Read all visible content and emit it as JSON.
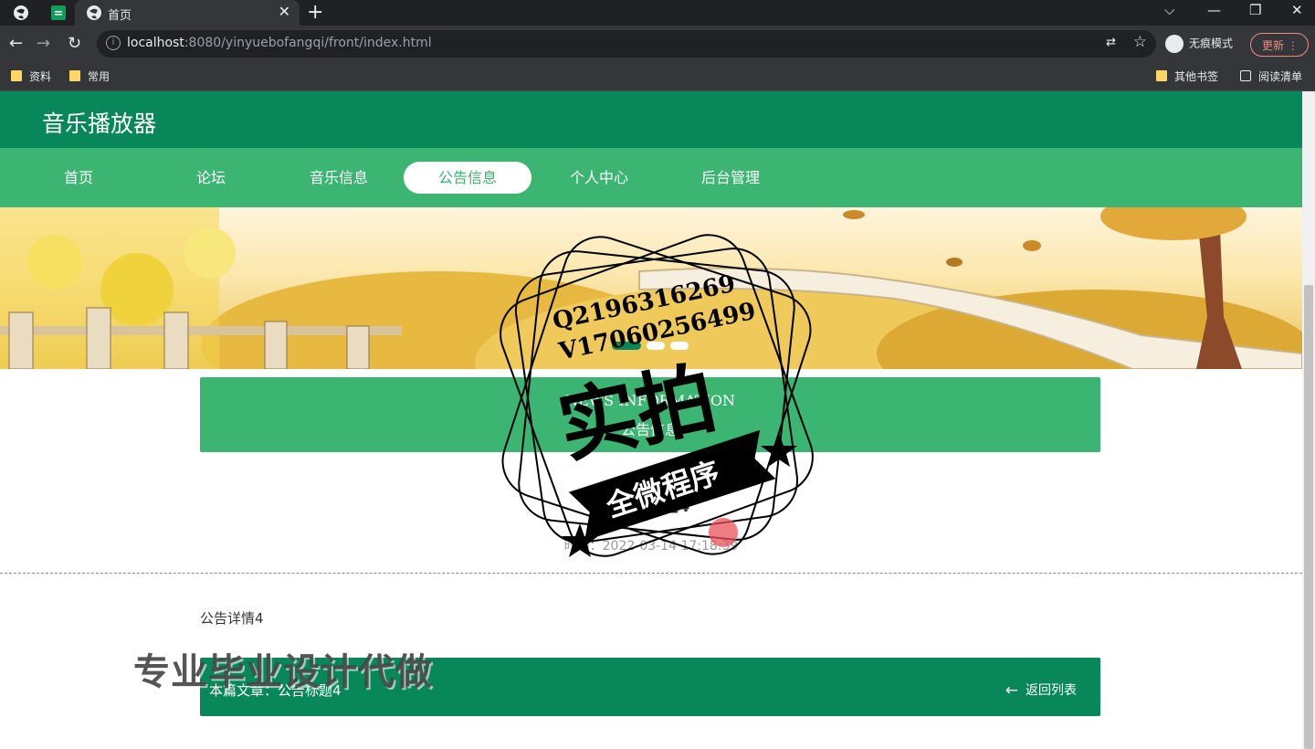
{
  "browser": {
    "tab_title": "首页",
    "url_host": "localhost",
    "url_rest": ":8080/yinyuebofangqi/front/index.html",
    "incognito_label": "无痕模式",
    "update_label": "更新",
    "bookmarks": [
      {
        "label": "资料"
      },
      {
        "label": "常用"
      }
    ],
    "other_bookmarks": "其他书签",
    "reading_list": "阅读清单"
  },
  "site": {
    "title": "音乐播放器",
    "nav": [
      {
        "label": "首页"
      },
      {
        "label": "论坛"
      },
      {
        "label": "音乐信息"
      },
      {
        "label": "公告信息",
        "active": true
      },
      {
        "label": "个人中心"
      },
      {
        "label": "后台管理"
      }
    ],
    "accent": "#3cb472",
    "header_color": "#07875a"
  },
  "section": {
    "title_en": "NEWS INFORMATION",
    "title_cn": "公告信息"
  },
  "news": {
    "title": "公告标题4",
    "time": "时间：2022-03-14 17:18:39",
    "content": "公告详情4",
    "this_article": "本篇文章：公告标题4",
    "back_label": "返回列表"
  },
  "overlay": {
    "qq": "Q2196316269",
    "wechat": "V17060256499",
    "stamp_big": "实拍",
    "stamp_ribbon": "全微程序",
    "bottom_text": "专业毕业设计代做"
  }
}
